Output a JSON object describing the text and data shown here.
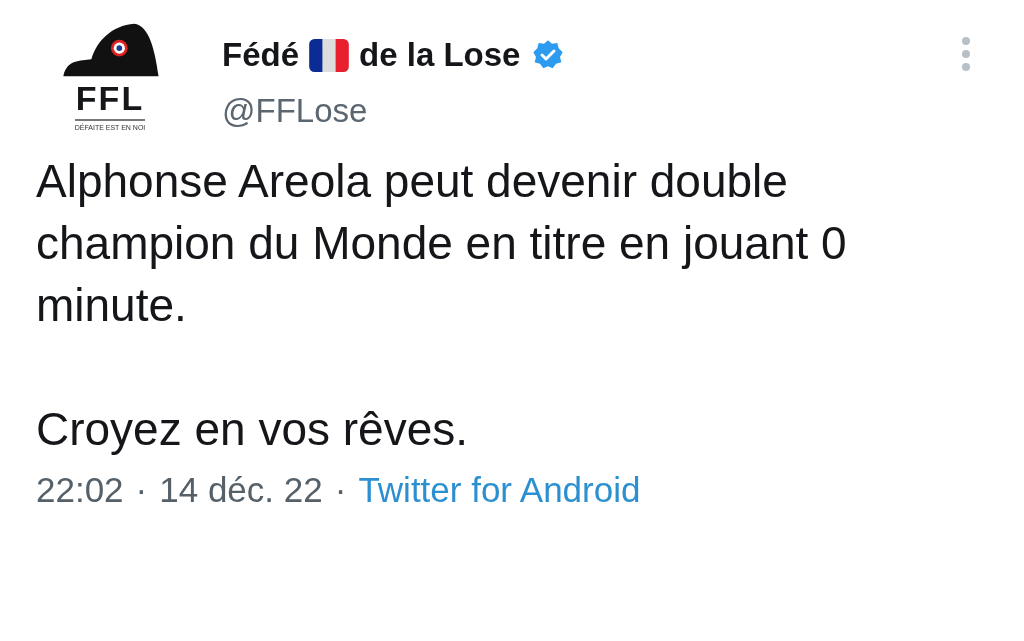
{
  "author": {
    "avatar": {
      "logo_text": "FFL",
      "motto": "DÉFAITE EST EN NOI"
    },
    "name_before_flag": "Fédé",
    "name_after_flag": "de la Lose",
    "verified": true,
    "handle": "@FFLose"
  },
  "tweet": {
    "paragraphs": [
      "Alphonse Areola peut devenir double champion du Monde en titre en jouant 0 minute.",
      "Croyez en vos rêves."
    ]
  },
  "meta": {
    "time": "22:02",
    "separator_1": "·",
    "date": "14 déc. 22",
    "separator_2": "·",
    "source": "Twitter for Android"
  }
}
